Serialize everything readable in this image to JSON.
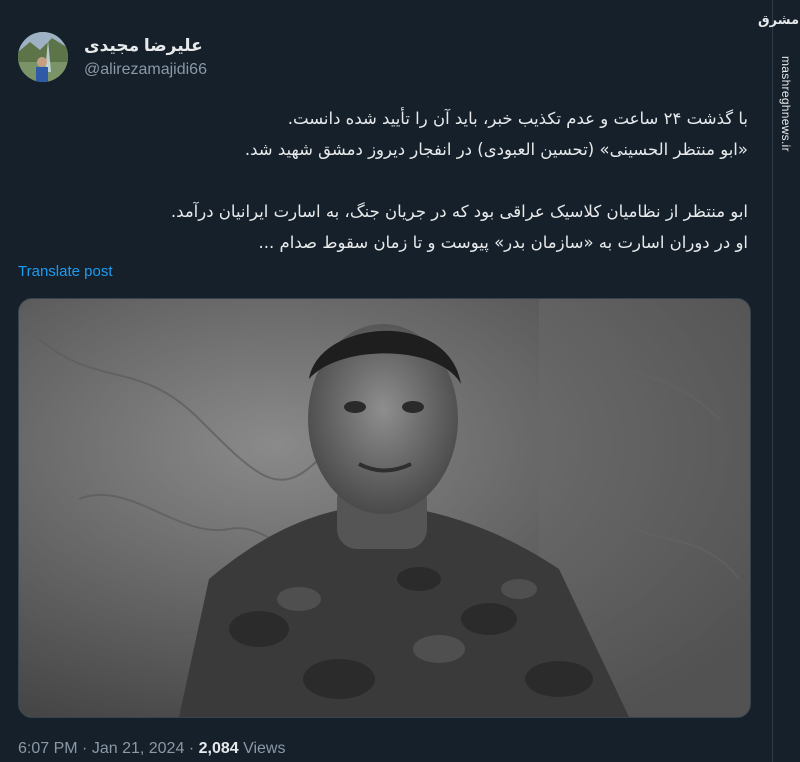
{
  "user": {
    "name": "علیرضا مجیدی",
    "handle": "@alirezamajidi66"
  },
  "tweet": {
    "lines": [
      "با گذشت ۲۴ ساعت و عدم تکذیب خبر، باید آن را تأیید شده دانست.",
      "«ابو منتظر الحسینی» (تحسین العبودی) در انفجار دیروز دمشق شهید شد.",
      "ابو منتظر از نظامیان کلاسیک عراقی بود که در جریان جنگ، به اسارت ایرانیان درآمد.",
      "او در دوران اسارت به «سازمان بدر» پیوست و تا زمان سقوط صدام ..."
    ],
    "translate_label": "Translate post",
    "time": "6:07 PM",
    "separator": "·",
    "date": "Jan 21, 2024",
    "views_count": "2,084",
    "views_label": "Views"
  },
  "watermark": {
    "logo": "مشرق",
    "site": "mashreghnews.ir"
  },
  "colors": {
    "background": "#15202b",
    "text": "#e7e9ea",
    "muted": "#8b98a5",
    "link": "#1d9bf0"
  }
}
